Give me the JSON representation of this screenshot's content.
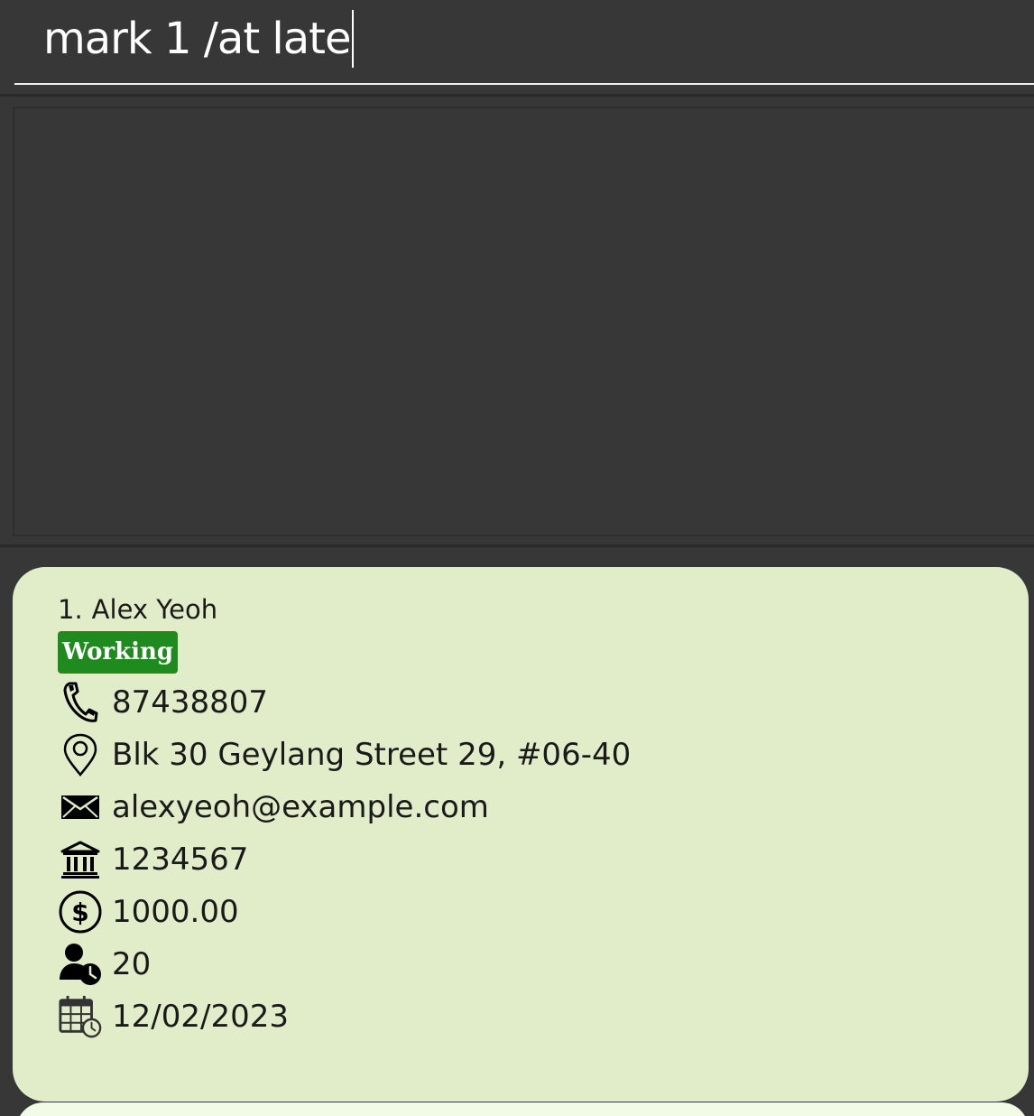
{
  "command_box": {
    "value": "mark 1 /at late"
  },
  "result_display": {
    "text": ""
  },
  "person_list": [
    {
      "index": "1.",
      "name": "Alex Yeoh",
      "tag": "Working",
      "phone": "87438807",
      "address": "Blk 30 Geylang Street 29, #06-40",
      "email": "alexyeoh@example.com",
      "bank_account": "1234567",
      "salary": "1000.00",
      "leaves": "20",
      "join_date": "12/02/2023"
    }
  ],
  "colors": {
    "background": "#373737",
    "card": "#e1edc8",
    "tag": "#1f8a1d",
    "command_text": "#ffffff"
  },
  "icons": [
    "phone-icon",
    "location-pin-icon",
    "envelope-icon",
    "bank-icon",
    "dollar-icon",
    "person-clock-icon",
    "calendar-clock-icon"
  ]
}
